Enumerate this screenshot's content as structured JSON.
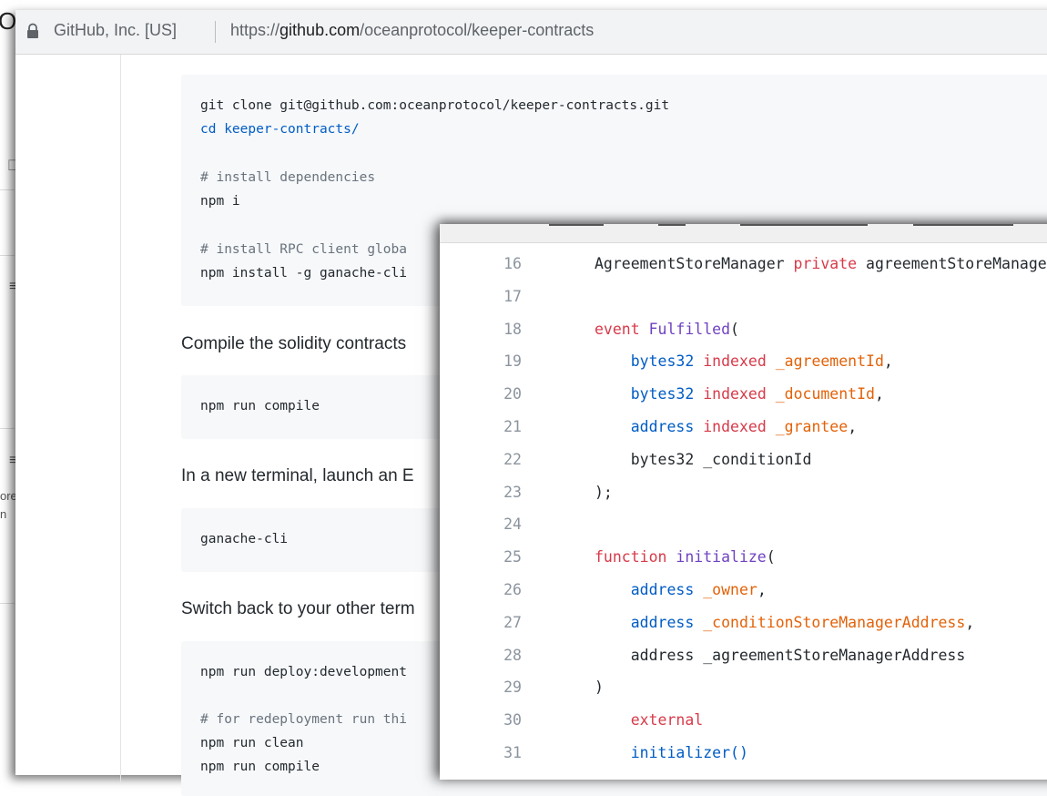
{
  "back_window": {
    "title_fragment": "O",
    "glyph": "☐",
    "menu_glyph": "≡",
    "text_frag_1": "ore",
    "text_frag_2": "n"
  },
  "browser": {
    "site_identity": "GitHub, Inc. [US]",
    "url_scheme": "https://",
    "url_host": "github.com",
    "url_path": "/oceanprotocol/keeper-contracts"
  },
  "readme": {
    "block1": {
      "lines": [
        "git clone git@github.com:oceanprotocol/keeper-contracts.git",
        "cd keeper-contracts/",
        "# install dependencies",
        "npm i",
        "# install RPC client globa",
        "npm install -g ganache-cli"
      ]
    },
    "prose1": "Compile the solidity contracts",
    "block2": {
      "lines": [
        "npm run compile"
      ]
    },
    "prose2": "In a new terminal, launch an E",
    "block3": {
      "lines": [
        "ganache-cli"
      ]
    },
    "prose3": "Switch back to your other term",
    "block4": {
      "lines": [
        "npm run deploy:development",
        "# for redeployment run thi",
        "npm run clean",
        "npm run compile"
      ]
    }
  },
  "code_view": {
    "rows": [
      {
        "n": "16",
        "tokens": [
          "AgreementStoreManager ",
          "private",
          " agreementStoreManager;"
        ]
      },
      {
        "n": "17",
        "tokens": []
      },
      {
        "n": "18",
        "tokens": [
          "event ",
          "Fulfilled",
          "("
        ]
      },
      {
        "n": "19",
        "tokens": [
          "    bytes32 ",
          "indexed ",
          "_agreementId",
          ","
        ]
      },
      {
        "n": "20",
        "tokens": [
          "    bytes32 ",
          "indexed ",
          "_documentId",
          ","
        ]
      },
      {
        "n": "21",
        "tokens": [
          "    address ",
          "indexed ",
          "_grantee",
          ","
        ]
      },
      {
        "n": "22",
        "tokens": [
          "    bytes32 _conditionId"
        ]
      },
      {
        "n": "23",
        "tokens": [
          ");"
        ]
      },
      {
        "n": "24",
        "tokens": []
      },
      {
        "n": "25",
        "tokens": [
          "function ",
          "initialize",
          "("
        ]
      },
      {
        "n": "26",
        "tokens": [
          "    address ",
          "_owner",
          ","
        ]
      },
      {
        "n": "27",
        "tokens": [
          "    address ",
          "_conditionStoreManagerAddress",
          ","
        ]
      },
      {
        "n": "28",
        "tokens": [
          "    address _agreementStoreManagerAddress"
        ]
      },
      {
        "n": "29",
        "tokens": [
          ")"
        ]
      },
      {
        "n": "30",
        "tokens": [
          "    external"
        ]
      },
      {
        "n": "31",
        "tokens": [
          "    initializer()"
        ]
      }
    ]
  },
  "colors": {
    "keyword_red": "#d73a49",
    "entity_purple": "#6f42c1",
    "type_blue": "#005cc5",
    "param_orange": "#e36209",
    "comment_gray": "#6a737d",
    "code_bg": "#f6f8fa"
  },
  "icons": {
    "lock": "lock-icon"
  }
}
